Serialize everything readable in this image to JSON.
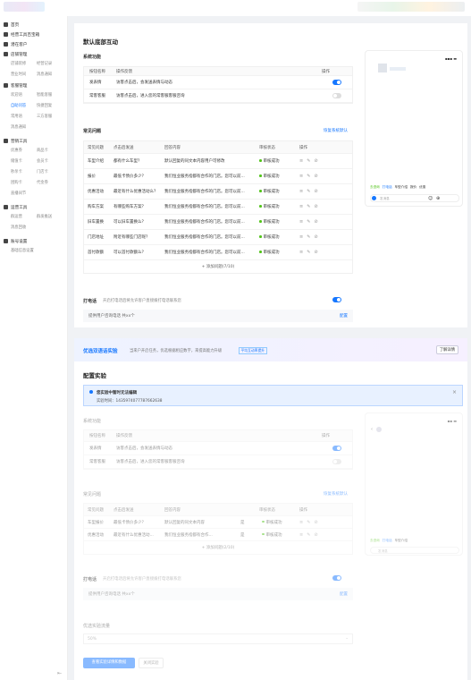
{
  "sidebar": {
    "home": "首页",
    "merchant_tools": "经营工具百宝箱",
    "new_customers": "潜在客户",
    "store_mgmt": {
      "title": "店铺管理",
      "items": [
        "店铺装修",
        "经营记录",
        "营业时间",
        "消息通知"
      ]
    },
    "customer_mgmt": {
      "title": "客服管理",
      "items": [
        "欢迎语",
        "智能客服",
        "自助问答",
        "快捷回复",
        "常用语",
        "三方客服",
        "消息通知"
      ]
    },
    "marketing": {
      "title": "营销工具",
      "items": [
        "优惠券",
        "商品卡",
        "储值卡",
        "会员卡",
        "秒杀卡",
        "门店卡",
        "团购卡",
        "代金券",
        "直播间节"
      ]
    },
    "tools": {
      "title": "运营工具",
      "items": [
        "群运营",
        "群发推送",
        "消息回收"
      ]
    },
    "settings": {
      "title": "账号设置",
      "items": [
        "基础信息设置"
      ]
    }
  },
  "page_title": "默认底部互动",
  "sys_section": {
    "title": "系统功能",
    "headers": [
      "按钮名称",
      "操作反馈",
      "",
      "操作"
    ],
    "rows": [
      {
        "name": "发表情",
        "desc": "访客点击后，会发送表情与动态",
        "on": true
      },
      {
        "name": "常客客服",
        "desc": "访客点击后，进入您的常客服客服咨询",
        "on": false
      }
    ]
  },
  "faq_section": {
    "title": "常见问题",
    "link": "恢复系统默认",
    "headers": [
      "常见问题",
      "点击后发送",
      "回答内容",
      "审核状态",
      "操作"
    ],
    "rows": [
      {
        "q": "车型介绍",
        "send": "都有什么车型？",
        "ans": "默认回复的同文本内容用户可修改",
        "status": "审核成功"
      },
      {
        "q": "报价",
        "send": "最低卡债价多少？",
        "ans": "我们恒业服务指都有合作的门店。您可以前...",
        "status": "审核成功"
      },
      {
        "q": "优惠活动",
        "send": "最近有什么优惠活动么？",
        "ans": "我们恒业服务指都有合作的门店。您可以前...",
        "status": "审核成功"
      },
      {
        "q": "购车方案",
        "send": "有哪些购车方案？",
        "ans": "我们恒业服务指都有合作的门店。您可以前...",
        "status": "审核成功"
      },
      {
        "q": "旧车置换",
        "send": "可以旧车置换么？",
        "ans": "我们恒业服务指都有合作的门店。您可以前...",
        "status": "审核成功"
      },
      {
        "q": "门店地址",
        "send": "附近有哪些门店呢？",
        "ans": "我们恒业服务指都有合作的门店。您可以前...",
        "status": "审核成功"
      },
      {
        "q": "首付款额",
        "send": "可以首付款额么？",
        "ans": "我们恒业服务指都有合作的门店。您可以前...",
        "status": "审核成功"
      }
    ],
    "add": "+ 添加问题(7/10)"
  },
  "phone_call": {
    "label": "打电话",
    "desc": "开启打电话后将允许客户直接拨打电话联系您",
    "sub": "提供用户咨询电话 共xx个",
    "sub_link": "配置"
  },
  "promo": {
    "title": "优选双语话实验",
    "desc": "当来户开启任务，优选根据相应数字，来提高能力升级",
    "tag": "平均互动率提升",
    "btn": "了解详情"
  },
  "config": {
    "title": "配置实验",
    "alert_title": "您实验中暂时无法编辑",
    "alert_desc": "实验时间：1435974077787662638",
    "sys_title": "系统功能",
    "sys_headers": [
      "按钮名称",
      "操作反馈",
      "操作"
    ],
    "sys_rows": [
      {
        "name": "发表情",
        "desc": "访客点击后，会发送表情与动态",
        "on": true
      },
      {
        "name": "常客客服",
        "desc": "访客点击后，进入您的常客服客服咨询",
        "on": false
      }
    ],
    "faq_title": "常见问题",
    "faq_link": "恢复系统默认",
    "faq_headers": [
      "常见问题",
      "点击后发送",
      "回答内容",
      "审核状态",
      "操作"
    ],
    "faq_rows": [
      {
        "q": "车型报价",
        "send": "最低卡债价多少？",
        "ans": "默认回复的同文本内容",
        "state": "是",
        "status": "审核成功"
      },
      {
        "q": "优惠活动",
        "send": "最近有什么优惠活动...",
        "ans": "我们恒业服务指都有合作...",
        "state": "是",
        "status": "审核成功"
      }
    ],
    "add": "+ 添加问题(2/10)",
    "phone_label": "打电话",
    "phone_desc": "开启打电话后将允许客户直接拨打电话联系您",
    "phone_sub": "提供用户咨询电话 共xx个",
    "phone_link": "配置",
    "traffic_title": "优选实验流量",
    "traffic_value": "50%",
    "btn_primary": "查看实验详情和数据",
    "btn_secondary": "关闭实验"
  },
  "preview": {
    "chat_chips": [
      "去咨询",
      "打电话",
      "车型介绍",
      "报价",
      "优惠"
    ],
    "input_placeholder": "发消息"
  },
  "colors": {
    "accent": "#1677ff",
    "success": "#52c41a",
    "promo_bg": "#eef3ff"
  }
}
